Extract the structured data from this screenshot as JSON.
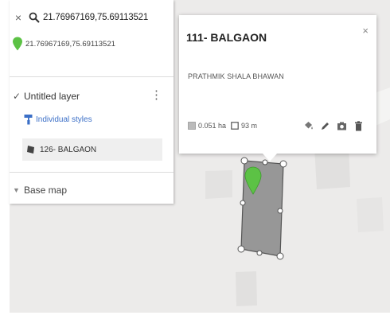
{
  "search": {
    "query": "21.76967169,75.69113521",
    "close_glyph": "×",
    "icon": "search-icon"
  },
  "result": {
    "text": "21.76967169,75.69113521",
    "icon": "green-pin-icon",
    "pin_color": "#5cc245"
  },
  "layer": {
    "title": "Untitled layer",
    "check_glyph": "✓",
    "more_glyph": "⋮",
    "styles_label": "Individual styles",
    "styles_icon": "paint-roller-icon",
    "feature_label": "126- BALGAON",
    "feature_icon": "polygon-icon"
  },
  "basemap": {
    "label": "Base map",
    "arrow_glyph": "▼"
  },
  "popup": {
    "title": "111- BALGAON",
    "close_glyph": "×",
    "description": "PRATHMIK SHALA BHAWAN",
    "area": "0.051 ha",
    "length": "93 m",
    "tools": [
      "fill-style-icon",
      "edit-pencil-icon",
      "camera-icon",
      "delete-trash-icon"
    ]
  },
  "colors": {
    "accent_blue": "#3b6fc7",
    "polygon_fill": "#8f8f8f",
    "map_background": "#ecebea"
  }
}
